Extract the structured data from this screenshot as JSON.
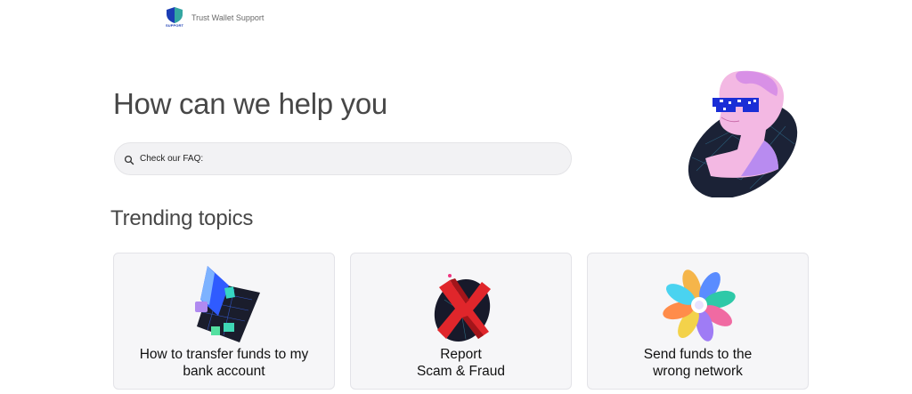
{
  "header": {
    "logo_sub": "SUPPORT",
    "brand_name": "Trust Wallet Support"
  },
  "hero": {
    "title": "How can we help you",
    "search_placeholder": "Check our FAQ:"
  },
  "trending": {
    "title": "Trending topics",
    "cards": [
      {
        "label": "How to transfer funds to my\nbank account",
        "icon": "bank-transfer-illustration"
      },
      {
        "label": "Report\nScam & Fraud",
        "icon": "scam-report-illustration"
      },
      {
        "label": "Send funds to the\nwrong network",
        "icon": "wrong-network-illustration"
      }
    ]
  },
  "colors": {
    "brand_blue": "#1b3db4",
    "title_gray": "#474747",
    "card_bg": "#f6f6f8"
  }
}
